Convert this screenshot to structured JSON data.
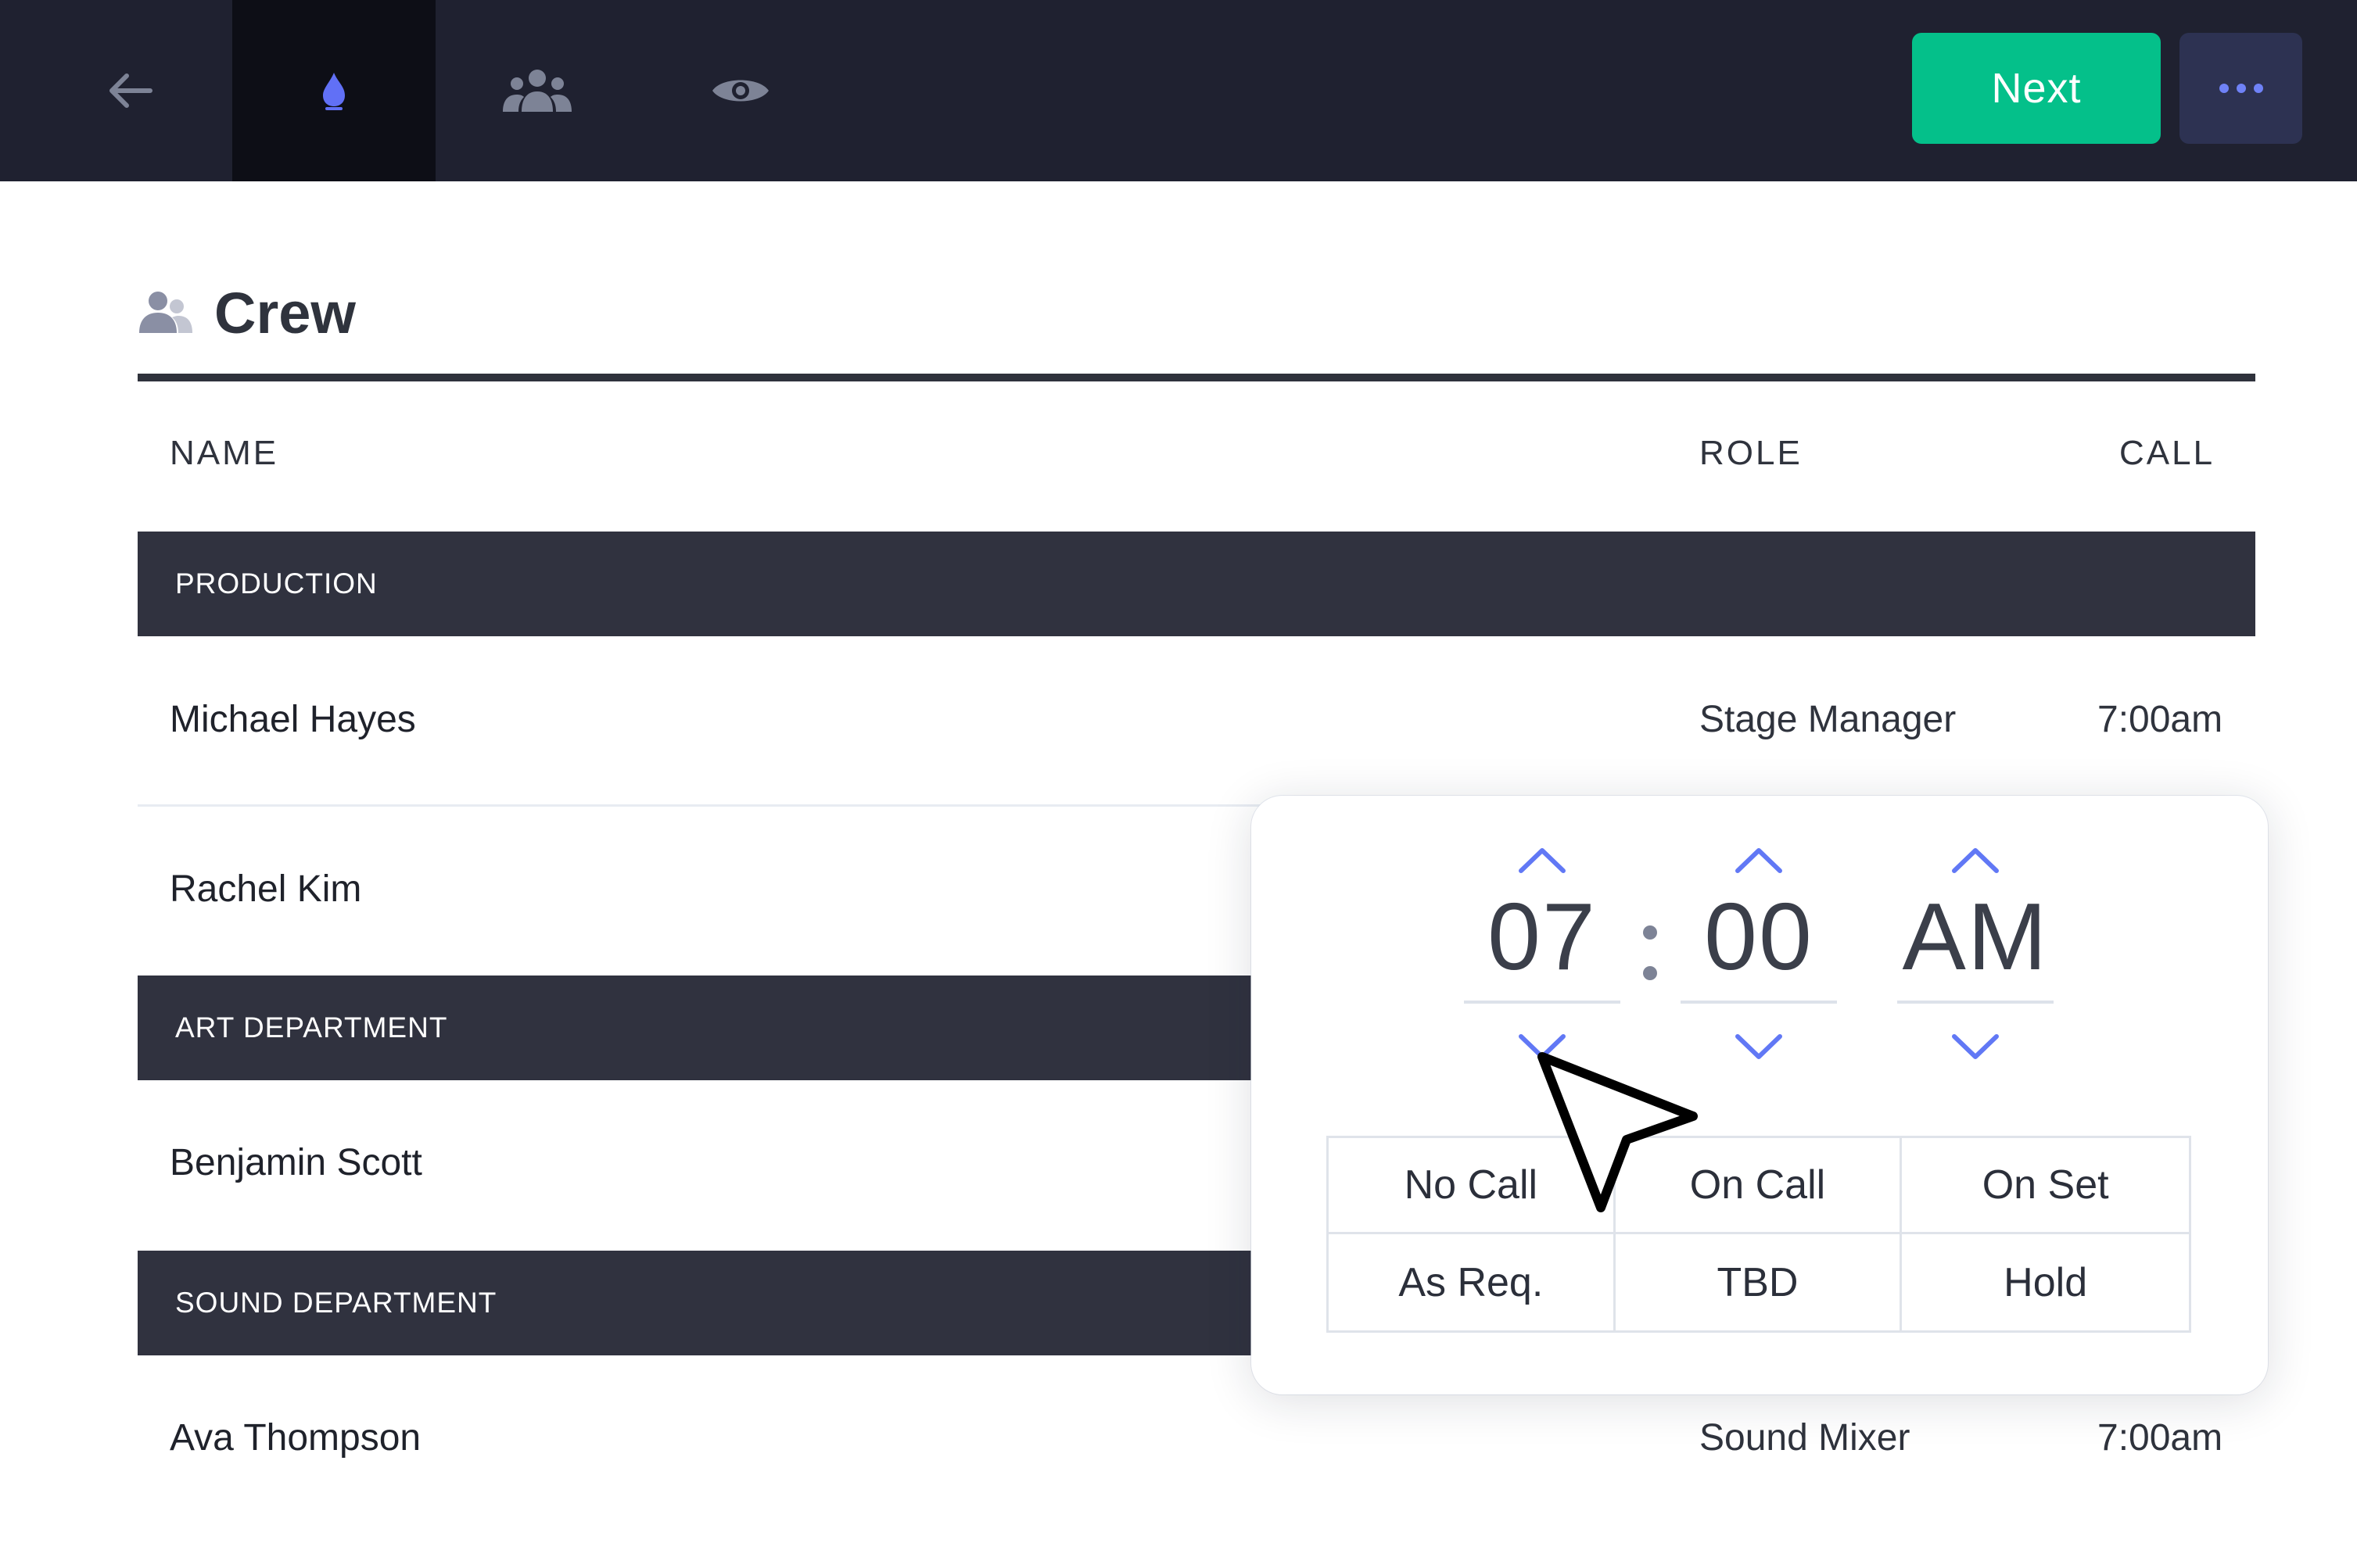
{
  "toolbar": {
    "icons": [
      "back-arrow-icon",
      "flame-icon",
      "people-icon",
      "eye-icon"
    ],
    "next_label": "Next",
    "more_icon": "more-dots-icon",
    "colors": {
      "bar": "#1f2130",
      "active": "#0d0e16",
      "next": "#04c08a",
      "more": "#2d3252",
      "accent": "#5b73f5"
    }
  },
  "section": {
    "icon": "people-icon",
    "title": "Crew"
  },
  "columns": {
    "name": "NAME",
    "role": "ROLE",
    "call": "CALL"
  },
  "groups": [
    {
      "label": "PRODUCTION"
    },
    {
      "label": "ART DEPARTMENT"
    },
    {
      "label": "SOUND DEPARTMENT"
    }
  ],
  "rows": [
    {
      "name": "Michael Hayes",
      "role": "Stage Manager",
      "call": "7:00am"
    },
    {
      "name": "Rachel Kim"
    },
    {
      "name": "Benjamin Scott"
    },
    {
      "name": "Ava Thompson",
      "role": "Sound Mixer",
      "call": "7:00am"
    }
  ],
  "picker": {
    "hour": "07",
    "minute": "00",
    "meridiem": "AM",
    "options": [
      "No Call",
      "On Call",
      "On Set",
      "As Req.",
      "TBD",
      "Hold"
    ]
  }
}
